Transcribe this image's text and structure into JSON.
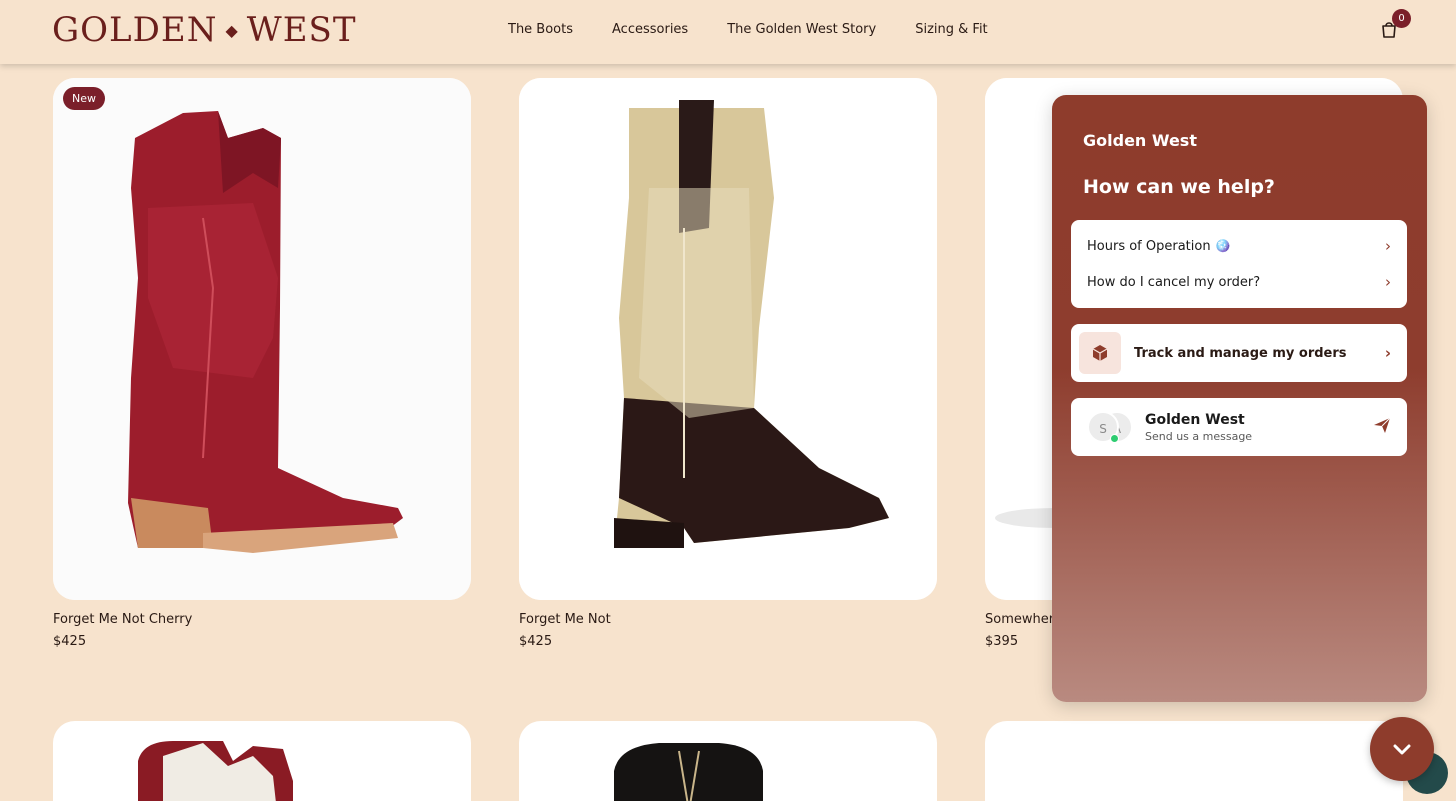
{
  "brand": {
    "logo_left": "GOLDEN",
    "logo_sep": "◆",
    "logo_right": "WEST"
  },
  "nav": {
    "items": [
      "The Boots",
      "Accessories",
      "The Golden West Story",
      "Sizing & Fit"
    ]
  },
  "cart": {
    "count": "0"
  },
  "products": [
    {
      "name": "Forget Me Not Cherry",
      "price": "$425",
      "badge": "New"
    },
    {
      "name": "Forget Me Not",
      "price": "$425"
    },
    {
      "name": "Somewhere",
      "price": "$395"
    }
  ],
  "chat": {
    "brand": "Golden West",
    "title": "How can we help?",
    "faq": [
      "Hours of Operation 🪩",
      "How do I cancel my order?"
    ],
    "track_label": "Track and manage my orders",
    "agent_initials": [
      "S",
      "A"
    ],
    "agent_name": "Golden West",
    "agent_sub": "Send us a message"
  },
  "colors": {
    "background": "#f7e3cd",
    "accent": "#8e3c2c",
    "brand": "#6a1f1c",
    "badge": "#7b1f2a"
  }
}
